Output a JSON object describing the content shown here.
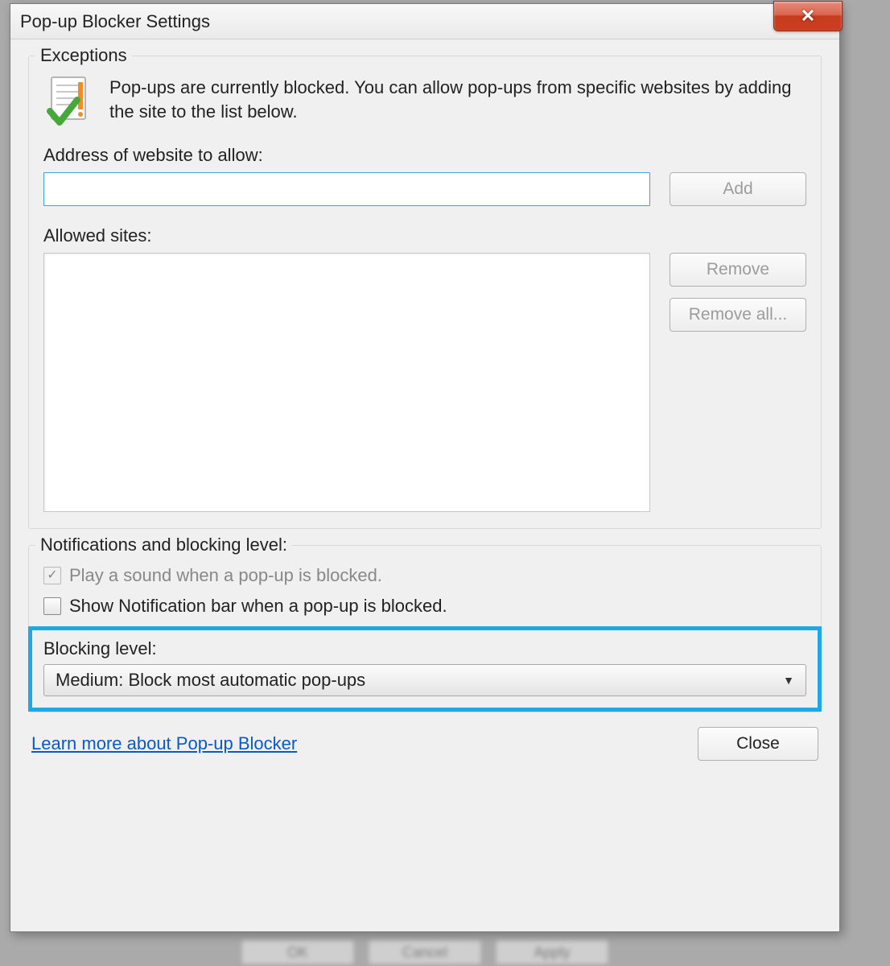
{
  "titlebar": {
    "title": "Pop-up Blocker Settings"
  },
  "exceptions": {
    "legend": "Exceptions",
    "info_text": "Pop-ups are currently blocked.  You can allow pop-ups from specific websites by adding the site to the list below.",
    "address_label": "Address of website to allow:",
    "address_value": "",
    "add_button": "Add",
    "allowed_label": "Allowed sites:",
    "remove_button": "Remove",
    "remove_all_button": "Remove all..."
  },
  "notifications": {
    "legend": "Notifications and blocking level:",
    "play_sound_label": "Play a sound when a pop-up is blocked.",
    "show_bar_label": "Show Notification bar when a pop-up is blocked.",
    "blocking_level_label": "Blocking level:",
    "blocking_level_value": "Medium: Block most automatic pop-ups"
  },
  "footer": {
    "link_text": "Learn more about Pop-up Blocker",
    "close_button": "Close"
  }
}
